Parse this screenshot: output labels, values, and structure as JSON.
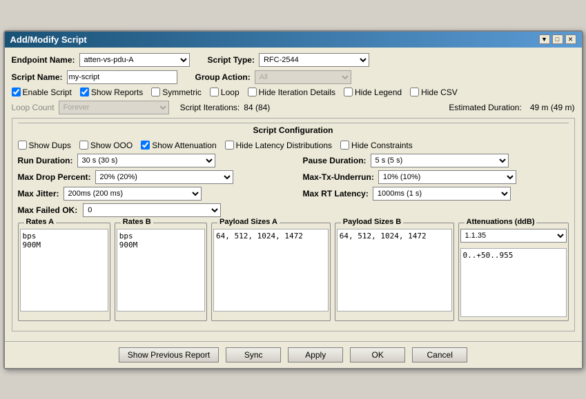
{
  "dialog": {
    "title": "Add/Modify Script",
    "title_buttons": [
      "▼",
      "□",
      "✕"
    ]
  },
  "form": {
    "endpoint_name_label": "Endpoint Name:",
    "endpoint_name_value": "atten-vs-pdu-A",
    "script_type_label": "Script Type:",
    "script_type_value": "RFC-2544",
    "script_name_label": "Script Name:",
    "script_name_value": "my-script",
    "group_action_label": "Group Action:",
    "group_action_value": "All",
    "enable_script_label": "Enable Script",
    "show_reports_label": "Show Reports",
    "symmetric_label": "Symmetric",
    "loop_label": "Loop",
    "hide_iteration_label": "Hide Iteration Details",
    "hide_legend_label": "Hide Legend",
    "hide_csv_label": "Hide CSV",
    "loop_count_label": "Loop Count",
    "loop_count_value": "Forever",
    "script_iterations_label": "Script Iterations:",
    "script_iterations_value": "84 (84)",
    "estimated_duration_label": "Estimated Duration:",
    "estimated_duration_value": "49 m (49 m)",
    "script_config_header": "Script Configuration",
    "show_dups_label": "Show Dups",
    "show_ooo_label": "Show OOO",
    "show_attenuation_label": "Show Attenuation",
    "hide_latency_label": "Hide Latency Distributions",
    "hide_constraints_label": "Hide Constraints",
    "run_duration_label": "Run Duration:",
    "run_duration_value": "30 s     (30 s)",
    "pause_duration_label": "Pause Duration:",
    "pause_duration_value": "5 s     (5 s)",
    "max_drop_label": "Max Drop Percent:",
    "max_drop_value": "20% (20%)",
    "max_tx_label": "Max-Tx-Underrun:",
    "max_tx_value": "10% (10%)",
    "max_jitter_label": "Max Jitter:",
    "max_jitter_value": "200ms (200 ms)",
    "max_rt_label": "Max RT Latency:",
    "max_rt_value": "1000ms (1 s)",
    "max_failed_label": "Max Failed OK:",
    "max_failed_value": "0",
    "rates_a_title": "Rates A",
    "rates_a_content": "bps\n900M",
    "rates_b_title": "Rates B",
    "rates_b_content": "bps\n900M",
    "payload_a_title": "Payload Sizes A",
    "payload_a_content": "64, 512, 1024, 1472",
    "payload_b_title": "Payload Sizes B",
    "payload_b_content": "64, 512, 1024, 1472",
    "attenuations_title": "Attenuations (ddB)",
    "attenuation_select_value": "1.1.35",
    "attenuation_content": "0..+50..955"
  },
  "footer": {
    "show_previous_label": "Show Previous Report",
    "sync_label": "Sync",
    "apply_label": "Apply",
    "ok_label": "OK",
    "cancel_label": "Cancel"
  }
}
